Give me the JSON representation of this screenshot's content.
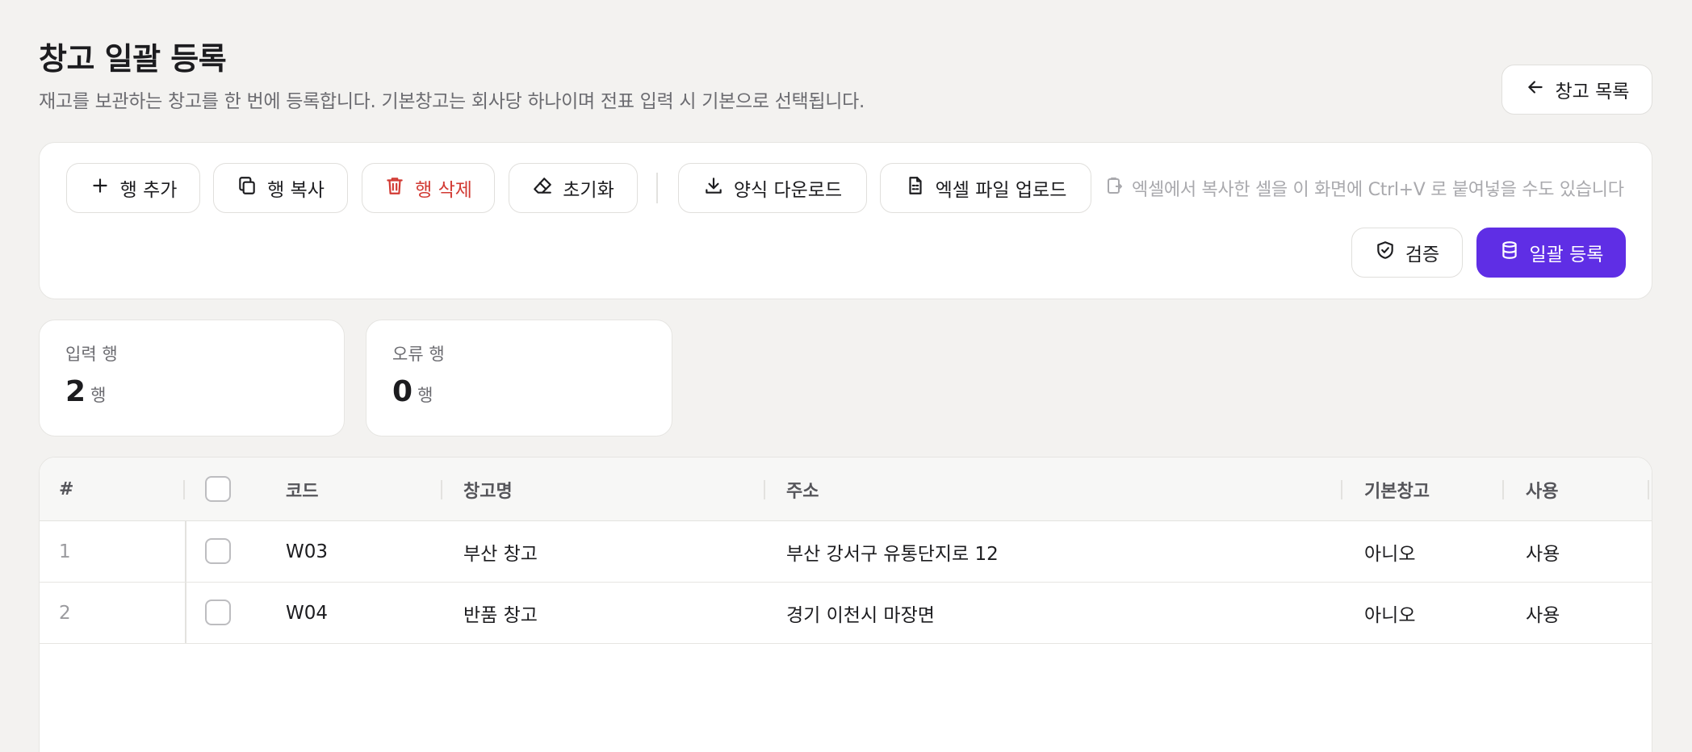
{
  "header": {
    "title": "창고 일괄 등록",
    "subtitle": "재고를 보관하는 창고를 한 번에 등록합니다. 기본창고는 회사당 하나이며 전표 입력 시 기본으로 선택됩니다.",
    "back_label": "창고 목록"
  },
  "toolbar": {
    "add_row": "행 추가",
    "copy_row": "행 복사",
    "delete_row": "행 삭제",
    "reset": "초기화",
    "download_template": "양식 다운로드",
    "upload_excel": "엑셀 파일 업로드",
    "paste_hint": "엑셀에서 복사한 셀을 이 화면에 Ctrl+V 로 붙여넣을 수도 있습니다",
    "validate": "검증",
    "bulk_register": "일괄 등록"
  },
  "stats": {
    "input_rows": {
      "label": "입력 행",
      "value": "2",
      "unit": "행"
    },
    "error_rows": {
      "label": "오류 행",
      "value": "0",
      "unit": "행"
    }
  },
  "table": {
    "headers": {
      "num": "#",
      "code": "코드",
      "name": "창고명",
      "address": "주소",
      "default": "기본창고",
      "use": "사용"
    },
    "rows": [
      {
        "num": "1",
        "code": "W03",
        "name": "부산 창고",
        "address": "부산 강서구 유통단지로 12",
        "default": "아니오",
        "use": "사용"
      },
      {
        "num": "2",
        "code": "W04",
        "name": "반품 창고",
        "address": "경기 이천시 마장면",
        "default": "아니오",
        "use": "사용"
      }
    ]
  },
  "colors": {
    "primary": "#5f2ee5",
    "danger": "#d23a33",
    "background": "#f3f2f0"
  }
}
